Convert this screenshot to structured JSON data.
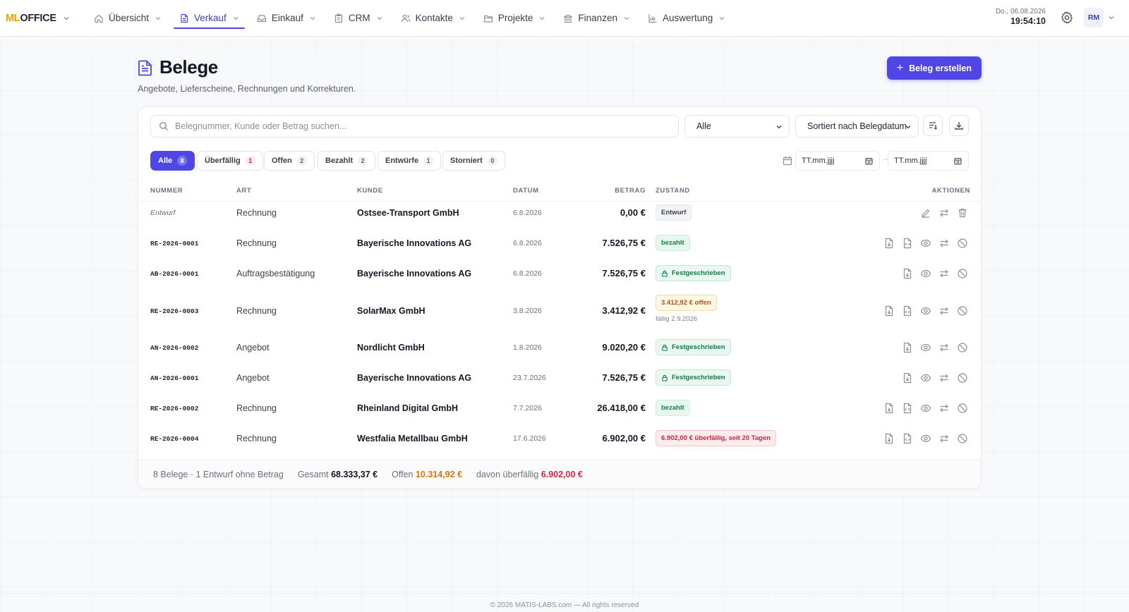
{
  "app": {
    "logo_ml": "ML",
    "logo_office": "OFFICE"
  },
  "nav": [
    {
      "label": "Übersicht",
      "icon": "home-icon"
    },
    {
      "label": "Verkauf",
      "icon": "document-icon",
      "active": true
    },
    {
      "label": "Einkauf",
      "icon": "inbox-icon"
    },
    {
      "label": "CRM",
      "icon": "clipboard-icon"
    },
    {
      "label": "Kontakte",
      "icon": "users-icon"
    },
    {
      "label": "Projekte",
      "icon": "folder-icon"
    },
    {
      "label": "Finanzen",
      "icon": "bank-icon"
    },
    {
      "label": "Auswertung",
      "icon": "chart-icon"
    }
  ],
  "header": {
    "date": "Do., 06.08.2026",
    "time": "19:54:10",
    "avatar": "RM"
  },
  "page": {
    "title": "Belege",
    "subtitle": "Angebote, Lieferscheine, Rechnungen und Korrekturen.",
    "create_label": "Beleg erstellen"
  },
  "toolbar": {
    "search_placeholder": "Belegnummer, Kunde oder Betrag suchen...",
    "status_value": "Alle",
    "sort_value": "Sortiert nach Belegdatum"
  },
  "filters": [
    {
      "label": "Alle",
      "count": "8",
      "active": true
    },
    {
      "label": "Überfällig",
      "count": "1",
      "red": true
    },
    {
      "label": "Offen",
      "count": "2"
    },
    {
      "label": "Bezahlt",
      "count": "2"
    },
    {
      "label": "Entwürfe",
      "count": "1"
    },
    {
      "label": "Storniert",
      "count": "0"
    }
  ],
  "date_filter": {
    "from_placeholder": "TT.mm.jjjj",
    "to_placeholder": "TT.mm.jjjj",
    "separator": "–"
  },
  "table": {
    "columns": [
      "NUMMER",
      "ART",
      "KUNDE",
      "DATUM",
      "BETRAG",
      "ZUSTAND",
      "AKTIONEN"
    ],
    "rows": [
      {
        "number": "Entwurf",
        "draft": true,
        "type": "Rechnung",
        "customer": "Ostsee-Transport GmbH",
        "date": "6.8.2026",
        "amount": "0,00 €",
        "status": "Entwurf",
        "status_kind": "draft",
        "actions": [
          "edit-icon",
          "convert-icon",
          "trash-icon"
        ]
      },
      {
        "number": "RE-2026-0001",
        "type": "Rechnung",
        "customer": "Bayerische Innovations AG",
        "date": "6.8.2026",
        "amount": "7.526,75 €",
        "status": "bezahlt",
        "status_kind": "paid",
        "actions": [
          "pdf-download-icon",
          "xml-file-icon",
          "view-icon",
          "convert-icon",
          "cancel-icon"
        ]
      },
      {
        "number": "AB-2026-0001",
        "type": "Auftragsbestätigung",
        "customer": "Bayerische Innovations AG",
        "date": "6.8.2026",
        "amount": "7.526,75 €",
        "status": "Festgeschrieben",
        "status_kind": "fixed",
        "actions": [
          "pdf-download-icon",
          "view-icon",
          "convert-icon",
          "cancel-icon"
        ]
      },
      {
        "number": "RE-2026-0003",
        "type": "Rechnung",
        "customer": "SolarMax GmbH",
        "date": "3.8.2026",
        "amount": "3.412,92 €",
        "status": "3.412,92 € offen",
        "status_kind": "open",
        "due": "fällig 2.9.2026",
        "actions": [
          "pdf-download-icon",
          "xml-file-icon",
          "view-icon",
          "convert-icon",
          "cancel-icon"
        ]
      },
      {
        "number": "AN-2026-0002",
        "type": "Angebot",
        "customer": "Nordlicht GmbH",
        "date": "1.8.2026",
        "amount": "9.020,20 €",
        "status": "Festgeschrieben",
        "status_kind": "fixed",
        "actions": [
          "pdf-download-icon",
          "view-icon",
          "convert-icon",
          "cancel-icon"
        ]
      },
      {
        "number": "AN-2026-0001",
        "type": "Angebot",
        "customer": "Bayerische Innovations AG",
        "date": "23.7.2026",
        "amount": "7.526,75 €",
        "status": "Festgeschrieben",
        "status_kind": "fixed",
        "actions": [
          "pdf-download-icon",
          "view-icon",
          "convert-icon",
          "cancel-icon"
        ]
      },
      {
        "number": "RE-2026-0002",
        "type": "Rechnung",
        "customer": "Rheinland Digital GmbH",
        "date": "7.7.2026",
        "amount": "26.418,00 €",
        "status": "bezahlt",
        "status_kind": "paid",
        "actions": [
          "pdf-download-icon",
          "xml-file-icon",
          "view-icon",
          "convert-icon",
          "cancel-icon"
        ]
      },
      {
        "number": "RE-2026-0004",
        "type": "Rechnung",
        "customer": "Westfalia Metallbau GmbH",
        "date": "17.6.2026",
        "amount": "6.902,00 €",
        "status": "6.902,00 € überfällig, seit 20 Tagen",
        "status_kind": "overdue",
        "actions": [
          "pdf-download-icon",
          "xml-file-icon",
          "view-icon",
          "convert-icon",
          "cancel-icon"
        ]
      }
    ]
  },
  "summary": {
    "count_text": "8 Belege · 1 Entwurf ohne Betrag",
    "total_label": "Gesamt",
    "total_value": "68.333,37 €",
    "open_label": "Offen",
    "open_value": "10.314,92 €",
    "overdue_label": "davon überfällig",
    "overdue_value": "6.902,00 €"
  },
  "footer": {
    "copyright": "© 2026 MATIS-LABS.com — All rights reserved"
  },
  "colors": {
    "accent": "#4f46e5",
    "paid": "#14804a",
    "open": "#b45309",
    "overdue": "#c8283f",
    "logo_ml": "#e0a400"
  }
}
